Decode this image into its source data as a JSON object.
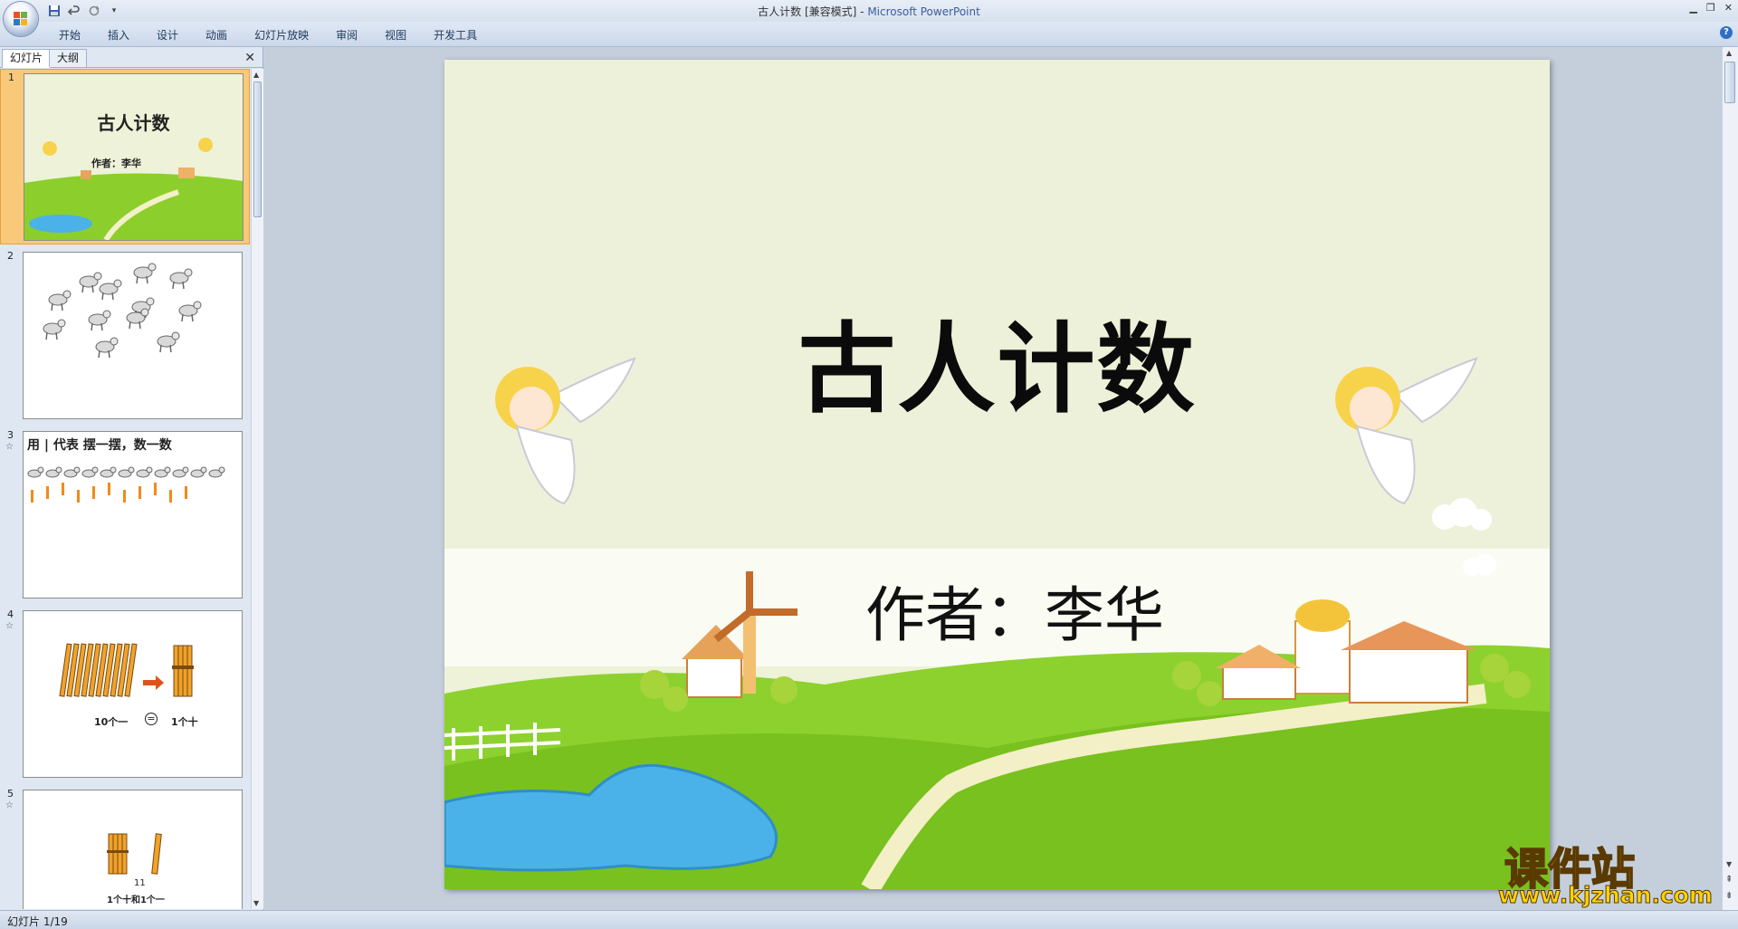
{
  "window": {
    "title_doc": "古人计数 [兼容模式]",
    "title_sep": " - ",
    "title_app": "Microsoft PowerPoint"
  },
  "qat": {
    "save_icon": "save-icon",
    "undo_icon": "undo-icon",
    "redo_icon": "redo-icon",
    "customize_icon": "chevron-down-icon"
  },
  "ribbon": {
    "tabs": [
      "开始",
      "插入",
      "设计",
      "动画",
      "幻灯片放映",
      "审阅",
      "视图",
      "开发工具"
    ]
  },
  "panel": {
    "tab_slides": "幻灯片",
    "tab_outline": "大纲",
    "close": "✕"
  },
  "thumbnails": [
    {
      "num": "1",
      "title": "古人计数",
      "author": "作者：李华"
    },
    {
      "num": "2"
    },
    {
      "num": "3",
      "text": "用 | 代表   摆一摆，数一数"
    },
    {
      "num": "4",
      "left_label": "10个一",
      "eq": "=",
      "right_label": "1个十"
    },
    {
      "num": "5",
      "count": "11",
      "caption": "1个十和1个一"
    }
  ],
  "slide": {
    "title": "古人计数",
    "author": "作者：李华"
  },
  "status": {
    "slide_info": "幻灯片 1/19"
  },
  "watermark": {
    "title": "课件站",
    "url": "www.kjzhan.com"
  },
  "colors": {
    "accent": "#3b5e9c",
    "selected_thumb": "#f9c97a",
    "grass": "#7cc21a",
    "sky": "#eef2d8",
    "water": "#4ab2e8"
  }
}
